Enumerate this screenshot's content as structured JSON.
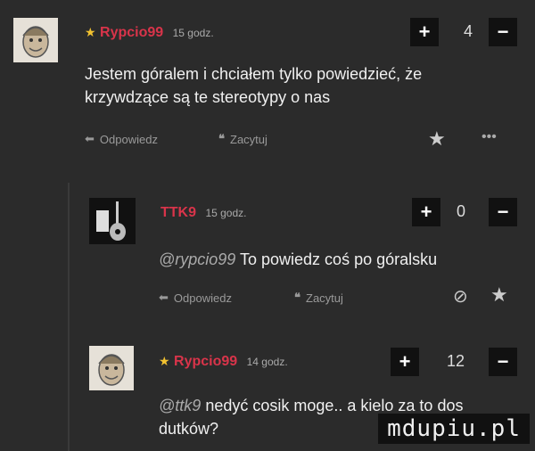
{
  "comments": [
    {
      "username": "Rypcio99",
      "time": "15 godz.",
      "votes": "4",
      "text": "Jestem góralem i chciałem tylko powiedzieć, że krzywdzące są te stereotypy o nas",
      "reply_label": "Odpowiedz",
      "quote_label": "Zacytuj"
    },
    {
      "username": "TTK9",
      "time": "15 godz.",
      "votes": "0",
      "mention": "@rypcio99",
      "text": "To powiedz coś po góralsku",
      "reply_label": "Odpowiedz",
      "quote_label": "Zacytuj"
    },
    {
      "username": "Rypcio99",
      "time": "14 godz.",
      "votes": "12",
      "mention": "@ttk9",
      "text": "nedyć cosik moge.. a kielo za to dos dutków?"
    }
  ],
  "watermark": "mdupiu.pl",
  "colors": {
    "username": "#d9344a",
    "star": "#f2c230",
    "background": "#2b2b2b"
  }
}
